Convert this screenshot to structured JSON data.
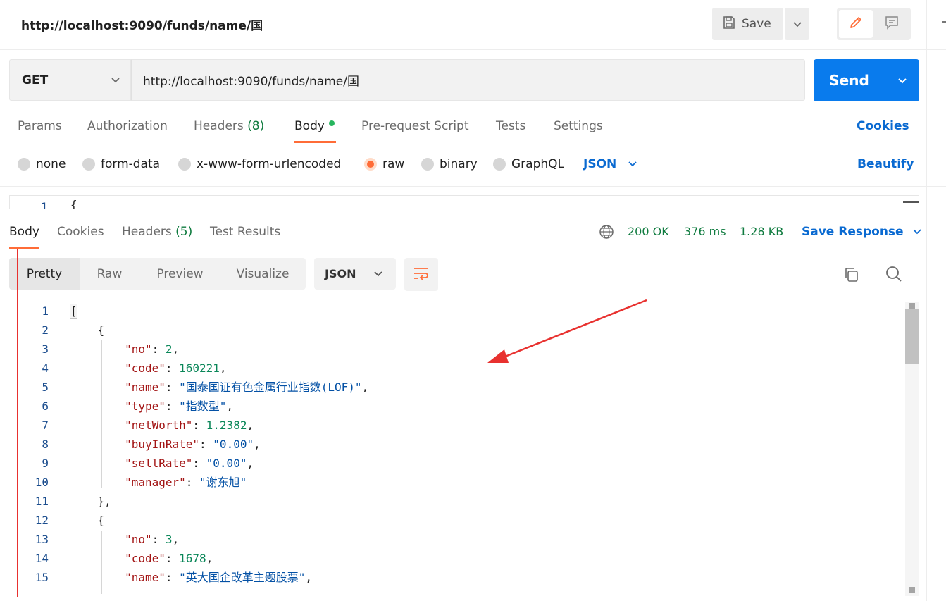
{
  "header": {
    "title": "http://localhost:9090/funds/name/国",
    "save_label": "Save"
  },
  "request": {
    "method": "GET",
    "url": "http://localhost:9090/funds/name/国",
    "send_label": "Send",
    "tabs": {
      "params": "Params",
      "authorization": "Authorization",
      "headers": "Headers",
      "headers_count": "(8)",
      "body": "Body",
      "pre_request": "Pre-request Script",
      "tests": "Tests",
      "settings": "Settings"
    },
    "cookies_link": "Cookies",
    "body_types": {
      "none": "none",
      "form_data": "form-data",
      "urlencoded": "x-www-form-urlencoded",
      "raw": "raw",
      "binary": "binary",
      "graphql": "GraphQL"
    },
    "raw_format": "JSON",
    "beautify_link": "Beautify",
    "editor_line_num": "1",
    "editor_line_code": "{"
  },
  "response": {
    "tabs": {
      "body": "Body",
      "cookies": "Cookies",
      "headers": "Headers",
      "headers_count": "(5)",
      "test_results": "Test Results"
    },
    "status": "200 OK",
    "time": "376 ms",
    "size": "1.28 KB",
    "save_response": "Save Response",
    "views": {
      "pretty": "Pretty",
      "raw": "Raw",
      "preview": "Preview",
      "visualize": "Visualize"
    },
    "format": "JSON",
    "lines": [
      {
        "num": "1",
        "text": "["
      },
      {
        "num": "2",
        "text": "    {"
      },
      {
        "num": "3",
        "key": "\"no\"",
        "sep": ": ",
        "val": "2",
        "type": "n",
        "end": ","
      },
      {
        "num": "4",
        "key": "\"code\"",
        "sep": ": ",
        "val": "160221",
        "type": "n",
        "end": ","
      },
      {
        "num": "5",
        "key": "\"name\"",
        "sep": ": ",
        "val": "\"国泰国证有色金属行业指数(LOF)\"",
        "type": "s",
        "end": ","
      },
      {
        "num": "6",
        "key": "\"type\"",
        "sep": ": ",
        "val": "\"指数型\"",
        "type": "s",
        "end": ","
      },
      {
        "num": "7",
        "key": "\"netWorth\"",
        "sep": ": ",
        "val": "1.2382",
        "type": "n",
        "end": ","
      },
      {
        "num": "8",
        "key": "\"buyInRate\"",
        "sep": ": ",
        "val": "\"0.00\"",
        "type": "s",
        "end": ","
      },
      {
        "num": "9",
        "key": "\"sellRate\"",
        "sep": ": ",
        "val": "\"0.00\"",
        "type": "s",
        "end": ","
      },
      {
        "num": "10",
        "key": "\"manager\"",
        "sep": ": ",
        "val": "\"谢东旭\"",
        "type": "s",
        "end": ""
      },
      {
        "num": "11",
        "text": "    },"
      },
      {
        "num": "12",
        "text": "    {"
      },
      {
        "num": "13",
        "key": "\"no\"",
        "sep": ": ",
        "val": "3",
        "type": "n",
        "end": ","
      },
      {
        "num": "14",
        "key": "\"code\"",
        "sep": ": ",
        "val": "1678",
        "type": "n",
        "end": ","
      },
      {
        "num": "15",
        "key": "\"name\"",
        "sep": ": ",
        "val": "\"英大国企改革主题股票\"",
        "type": "s",
        "end": ","
      }
    ]
  },
  "colors": {
    "accent_orange": "#ff6c37",
    "send_blue": "#097bed",
    "link_blue": "#0a6ad1",
    "status_green": "#0f7b3f",
    "annotation_red": "#e8312f"
  }
}
